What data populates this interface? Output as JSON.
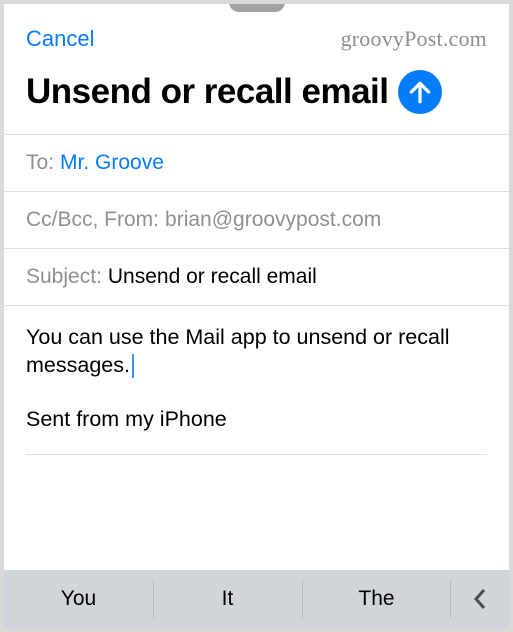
{
  "topbar": {
    "cancel": "Cancel",
    "watermark": "groovyPost.com"
  },
  "title": "Unsend or recall email",
  "fields": {
    "to_label": "To:",
    "to_value": "Mr. Groove",
    "ccbcc_label": "Cc/Bcc, From:",
    "ccbcc_value": "brian@groovypost.com",
    "subject_label": "Subject:",
    "subject_value": "Unsend or recall email"
  },
  "body": {
    "text": "You can use the Mail app to unsend or recall messages.",
    "signature": "Sent from my iPhone"
  },
  "keyboard": {
    "suggestions": [
      "You",
      "It",
      "The"
    ]
  }
}
